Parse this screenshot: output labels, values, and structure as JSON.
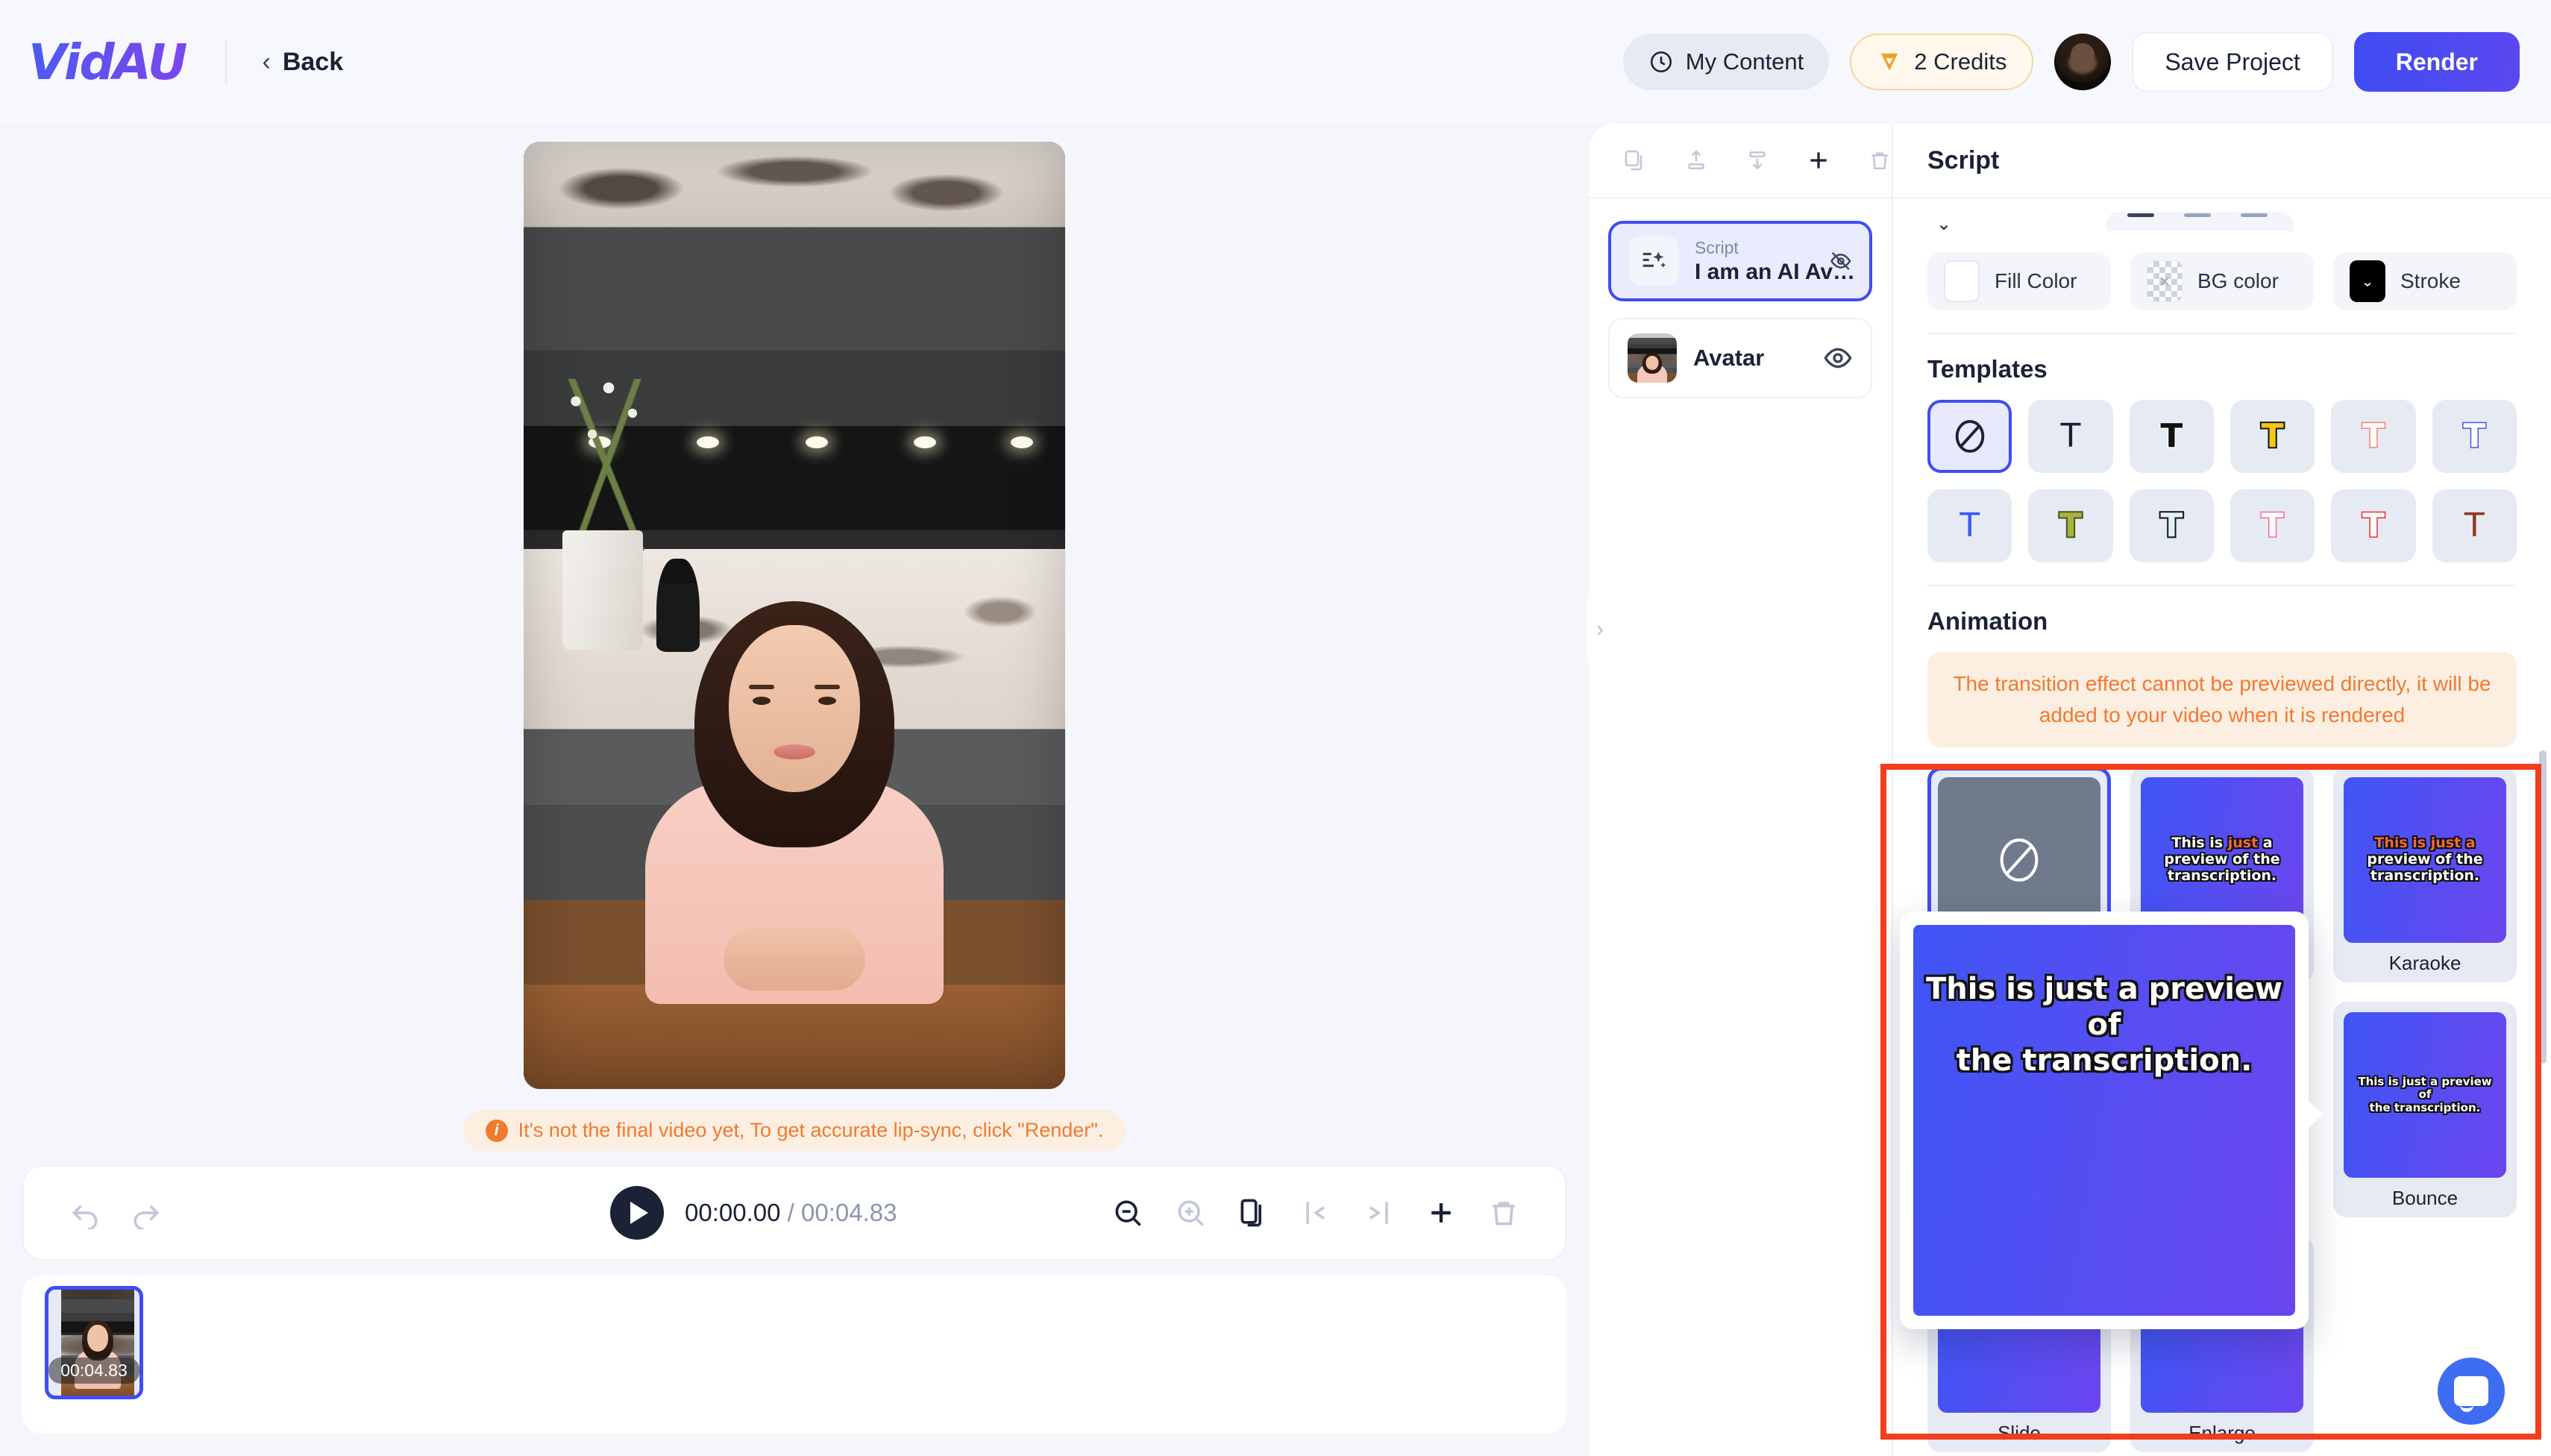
{
  "brand": {
    "logo_text": "VidAU",
    "accent": "#3f4df2"
  },
  "header": {
    "back_label": "Back",
    "my_content_label": "My Content",
    "credits_label": "2 Credits",
    "save_label": "Save Project",
    "render_label": "Render"
  },
  "canvas": {
    "notice": "It's not the final video yet, To get accurate lip-sync, click \"Render\"."
  },
  "timeline": {
    "current_time": "00:00.00",
    "separator": " / ",
    "total_time": "00:04.83",
    "clip_duration": "00:04.83"
  },
  "layers": {
    "items": [
      {
        "sub": "Script",
        "title": "I am an AI Av…",
        "visible": false,
        "selected": true
      },
      {
        "title": "Avatar",
        "visible": true,
        "selected": false
      }
    ]
  },
  "properties": {
    "panel_title": "Script",
    "fill_color_label": "Fill Color",
    "bg_color_label": "BG color",
    "stroke_label": "Stroke",
    "fill_color_value": "#ffffff",
    "bg_color_value": "transparent",
    "stroke_color_value": "#000000",
    "templates_title": "Templates",
    "templates": [
      {
        "name": "none",
        "glyph": "none"
      },
      {
        "name": "plain-thin",
        "fill": "#1b2236",
        "stroke": "none"
      },
      {
        "name": "black-outline",
        "fill": "#111111",
        "stroke": "#ffffff"
      },
      {
        "name": "yellow-outline",
        "fill": "#f5c518",
        "stroke": "#111111"
      },
      {
        "name": "salmon-outline",
        "fill": "#ffffff",
        "stroke": "#f4836b"
      },
      {
        "name": "blue-outline",
        "fill": "#ffffff",
        "stroke": "#3f55f5"
      },
      {
        "name": "blue-plain",
        "fill": "#3f55f5",
        "stroke": "#ffffff"
      },
      {
        "name": "olive-outline",
        "fill": "#a8b33c",
        "stroke": "#4a5420"
      },
      {
        "name": "ice-outline",
        "fill": "#dff0fb",
        "stroke": "#111111"
      },
      {
        "name": "pink-outline",
        "fill": "#ffffff",
        "stroke": "#f2699b"
      },
      {
        "name": "red-outline",
        "fill": "#ffffff",
        "stroke": "#ee2b2b"
      },
      {
        "name": "brown-plain",
        "fill": "#8c3a24",
        "stroke": "none"
      }
    ],
    "animation_title": "Animation",
    "animation_warning": "The transition effect cannot be previewed directly, it will be added to your video when it is rendered",
    "animations": [
      {
        "label": "",
        "kind": "none",
        "selected": true
      },
      {
        "label": "",
        "kind": "highlight",
        "selected": false
      },
      {
        "label": "Karaoke",
        "kind": "karaoke",
        "selected": false
      },
      {
        "label": "",
        "kind": "plain",
        "selected": false
      },
      {
        "label": "Bounce",
        "kind": "bounce",
        "selected": false
      },
      {
        "label": "Slide",
        "kind": "plain",
        "selected": false
      },
      {
        "label": "Enlarge",
        "kind": "plain",
        "selected": false
      }
    ],
    "preview_text_line1": "This is just a preview of",
    "preview_text_line2": "the transcription.",
    "preview_word_1": "This is ",
    "preview_word_hl": "just",
    "preview_word_2": " a",
    "preview_word_3": "preview of the",
    "preview_word_4": "transcription."
  }
}
